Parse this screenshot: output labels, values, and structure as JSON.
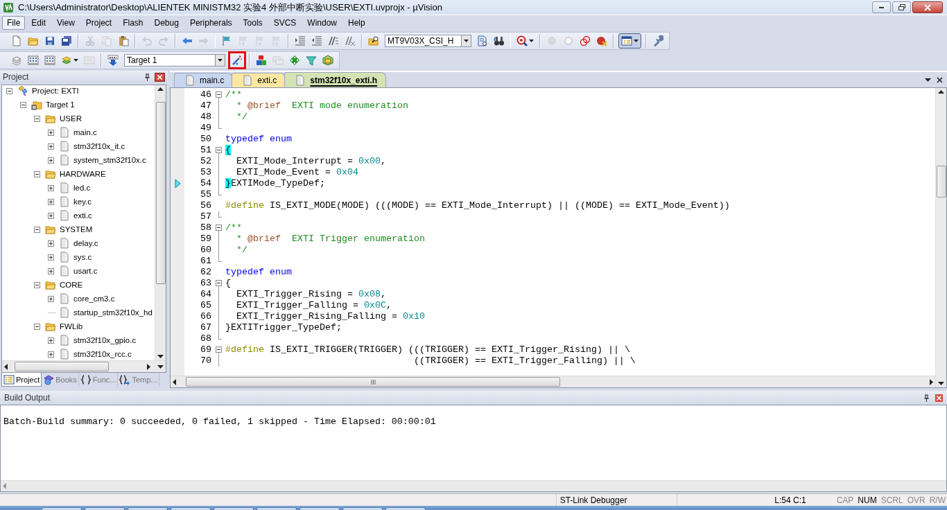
{
  "window": {
    "title": "C:\\Users\\Administrator\\Desktop\\ALIENTEK MINISTM32 实验4 外部中断实验\\USER\\EXTI.uvprojx - µVision"
  },
  "menu": [
    {
      "label": "File",
      "selected": true
    },
    {
      "label": "Edit",
      "selected": false
    },
    {
      "label": "View",
      "selected": false
    },
    {
      "label": "Project",
      "selected": false
    },
    {
      "label": "Flash",
      "selected": false
    },
    {
      "label": "Debug",
      "selected": false
    },
    {
      "label": "Peripherals",
      "selected": false
    },
    {
      "label": "Tools",
      "selected": false
    },
    {
      "label": "SVCS",
      "selected": false
    },
    {
      "label": "Window",
      "selected": false
    },
    {
      "label": "Help",
      "selected": false
    }
  ],
  "toolbar": {
    "find_combo": "MT9V03X_CSI_H"
  },
  "build_toolbar": {
    "target_combo": "Target 1",
    "options_highlighted": true
  },
  "project": {
    "title": "Project",
    "tree": [
      {
        "label": "Project: EXTI",
        "kind": "project",
        "expanded": true,
        "children": [
          {
            "label": "Target 1",
            "kind": "target",
            "expanded": true,
            "children": [
              {
                "label": "USER",
                "kind": "group",
                "expanded": true,
                "children": [
                  {
                    "label": "main.c",
                    "kind": "file",
                    "expanded": false
                  },
                  {
                    "label": "stm32f10x_it.c",
                    "kind": "file",
                    "expanded": false
                  },
                  {
                    "label": "system_stm32f10x.c",
                    "kind": "file",
                    "expanded": false
                  }
                ]
              },
              {
                "label": "HARDWARE",
                "kind": "group",
                "expanded": true,
                "children": [
                  {
                    "label": "led.c",
                    "kind": "file",
                    "expanded": false
                  },
                  {
                    "label": "key.c",
                    "kind": "file",
                    "expanded": false
                  },
                  {
                    "label": "exti.c",
                    "kind": "file",
                    "expanded": false
                  }
                ]
              },
              {
                "label": "SYSTEM",
                "kind": "group",
                "expanded": true,
                "children": [
                  {
                    "label": "delay.c",
                    "kind": "file",
                    "expanded": false
                  },
                  {
                    "label": "sys.c",
                    "kind": "file",
                    "expanded": false
                  },
                  {
                    "label": "usart.c",
                    "kind": "file",
                    "expanded": false
                  }
                ]
              },
              {
                "label": "CORE",
                "kind": "group",
                "expanded": true,
                "children": [
                  {
                    "label": "core_cm3.c",
                    "kind": "file",
                    "expanded": false
                  },
                  {
                    "label": "startup_stm32f10x_hd",
                    "kind": "leaf"
                  }
                ]
              },
              {
                "label": "FWLib",
                "kind": "group",
                "expanded": true,
                "children": [
                  {
                    "label": "stm32f10x_gpio.c",
                    "kind": "file",
                    "expanded": false
                  },
                  {
                    "label": "stm32f10x_rcc.c",
                    "kind": "file",
                    "expanded": false
                  }
                ]
              }
            ]
          }
        ]
      }
    ],
    "tabs": [
      {
        "label": "Project",
        "kind": "project",
        "selected": true
      },
      {
        "label": "Books",
        "kind": "books",
        "selected": false
      },
      {
        "label": "Func...",
        "kind": "functions",
        "selected": false
      },
      {
        "label": "Temp...",
        "kind": "templates",
        "selected": false
      }
    ]
  },
  "editor": {
    "tabs": [
      {
        "label": "main.c",
        "selected": false,
        "color": "#c9d6ef"
      },
      {
        "label": "exti.c",
        "selected": false,
        "color": "#fbe7a1"
      },
      {
        "label": "stm32f10x_exti.h",
        "selected": true,
        "color": "#d3e3b4"
      }
    ],
    "lines": [
      {
        "number": "46",
        "kind": "fold_start",
        "current": false,
        "tokens": [
          {
            "kind": "comment",
            "text": "/**"
          }
        ]
      },
      {
        "number": "47",
        "kind": "fold_inside",
        "current": false,
        "tokens": [
          {
            "kind": "comment",
            "text": "  * "
          },
          {
            "kind": "doctag",
            "text": "@brief"
          },
          {
            "kind": "comment",
            "text": "  EXTI mode enumeration"
          }
        ]
      },
      {
        "number": "48",
        "kind": "fold_inside",
        "current": false,
        "tokens": [
          {
            "kind": "comment",
            "text": "  */"
          }
        ]
      },
      {
        "number": "49",
        "kind": "fold_end",
        "current": false
      },
      {
        "number": "50",
        "kind": "plain",
        "current": false,
        "tokens": [
          {
            "kind": "keyword",
            "text": "typedef enum"
          }
        ]
      },
      {
        "number": "51",
        "kind": "fold_start",
        "current": false,
        "tokens": [
          {
            "kind": "match",
            "text": "{"
          }
        ]
      },
      {
        "number": "52",
        "kind": "fold_inside",
        "current": false,
        "tokens": [
          {
            "kind": "plain",
            "text": "  EXTI_Mode_Interrupt = "
          },
          {
            "kind": "number",
            "text": "0x00"
          },
          {
            "kind": "plain",
            "text": ","
          }
        ]
      },
      {
        "number": "53",
        "kind": "fold_inside",
        "current": false,
        "tokens": [
          {
            "kind": "plain",
            "text": "  EXTI_Mode_Event = "
          },
          {
            "kind": "number",
            "text": "0x04"
          }
        ]
      },
      {
        "number": "54",
        "kind": "fold_inside",
        "current": true,
        "tokens": [
          {
            "kind": "match",
            "text": "}"
          },
          {
            "kind": "plain",
            "text": "EXTIMode_TypeDef;"
          }
        ]
      },
      {
        "number": "55",
        "kind": "fold_end",
        "current": false
      },
      {
        "number": "56",
        "kind": "plain",
        "current": false,
        "tokens": [
          {
            "kind": "preproc",
            "text": "#define"
          },
          {
            "kind": "plain",
            "text": " IS_EXTI_MODE(MODE) (((MODE) == EXTI_Mode_Interrupt) || ((MODE) == EXTI_Mode_Event))"
          }
        ]
      },
      {
        "number": "57",
        "kind": "fold_end",
        "current": false
      },
      {
        "number": "58",
        "kind": "fold_start",
        "current": false,
        "tokens": [
          {
            "kind": "comment",
            "text": "/**"
          }
        ]
      },
      {
        "number": "59",
        "kind": "fold_inside",
        "current": false,
        "tokens": [
          {
            "kind": "comment",
            "text": "  * "
          },
          {
            "kind": "doctag",
            "text": "@brief"
          },
          {
            "kind": "comment",
            "text": "  EXTI Trigger enumeration"
          }
        ]
      },
      {
        "number": "60",
        "kind": "fold_inside",
        "current": false,
        "tokens": [
          {
            "kind": "comment",
            "text": "  */"
          }
        ]
      },
      {
        "number": "61",
        "kind": "fold_end",
        "current": false
      },
      {
        "number": "62",
        "kind": "plain",
        "current": false,
        "tokens": [
          {
            "kind": "keyword",
            "text": "typedef enum"
          }
        ]
      },
      {
        "number": "63",
        "kind": "fold_start",
        "current": false,
        "tokens": [
          {
            "kind": "plain",
            "text": "{"
          }
        ]
      },
      {
        "number": "64",
        "kind": "fold_inside",
        "current": false,
        "tokens": [
          {
            "kind": "plain",
            "text": "  EXTI_Trigger_Rising = "
          },
          {
            "kind": "number",
            "text": "0x08"
          },
          {
            "kind": "plain",
            "text": ","
          }
        ]
      },
      {
        "number": "65",
        "kind": "fold_inside",
        "current": false,
        "tokens": [
          {
            "kind": "plain",
            "text": "  EXTI_Trigger_Falling = "
          },
          {
            "kind": "number",
            "text": "0x0C"
          },
          {
            "kind": "plain",
            "text": ","
          }
        ]
      },
      {
        "number": "66",
        "kind": "fold_inside",
        "current": false,
        "tokens": [
          {
            "kind": "plain",
            "text": "  EXTI_Trigger_Rising_Falling = "
          },
          {
            "kind": "number",
            "text": "0x10"
          }
        ]
      },
      {
        "number": "67",
        "kind": "fold_inside",
        "current": false,
        "tokens": [
          {
            "kind": "plain",
            "text": "}EXTITrigger_TypeDef;"
          }
        ]
      },
      {
        "number": "68",
        "kind": "fold_end",
        "current": false
      },
      {
        "number": "69",
        "kind": "fold_start",
        "current": false,
        "tokens": [
          {
            "kind": "preproc",
            "text": "#define"
          },
          {
            "kind": "plain",
            "text": " IS_EXTI_TRIGGER(TRIGGER) (((TRIGGER) == EXTI_Trigger_Rising) || \\"
          }
        ]
      },
      {
        "number": "70",
        "kind": "fold_inside",
        "current": false,
        "tokens": [
          {
            "kind": "plain",
            "text": "                                  ((TRIGGER) == EXTI_Trigger_Falling) || \\"
          }
        ]
      }
    ]
  },
  "output": {
    "title": "Build Output",
    "text": "Batch-Build summary: 0 succeeded, 0 failed, 1 skipped - Time Elapsed: 00:00:01"
  },
  "status_bar": {
    "debugger": "ST-Link Debugger",
    "position": "L:54 C:1",
    "indicators": [
      {
        "label": "CAP",
        "on": false
      },
      {
        "label": "NUM",
        "on": true
      },
      {
        "label": "SCRL",
        "on": false
      },
      {
        "label": "OVR",
        "on": false
      },
      {
        "label": "R/W",
        "on": false
      }
    ]
  }
}
